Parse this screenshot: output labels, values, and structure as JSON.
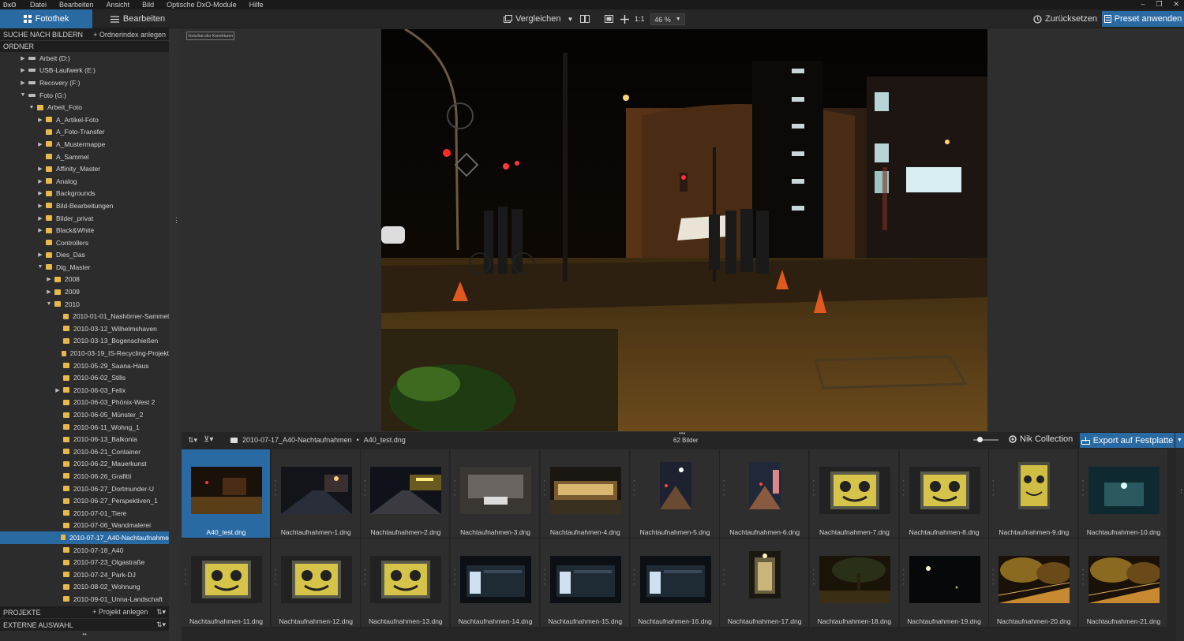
{
  "app": {
    "logo": "DxO"
  },
  "menu": [
    "Datei",
    "Bearbeiten",
    "Ansicht",
    "Bild",
    "Optische DxO-Module",
    "Hilfe"
  ],
  "window_controls": [
    "–",
    "❐",
    "✕"
  ],
  "tabs": {
    "library": "Fotothek",
    "edit": "Bearbeiten"
  },
  "toolbar": {
    "compare": "Vergleichen",
    "zoom_1_1": "1:1",
    "zoom_value": "46 %",
    "reset": "Zurücksetzen",
    "apply_preset": "Preset anwenden"
  },
  "left": {
    "search_header": "SUCHE NACH BILDERN",
    "index_action": "+ Ordnerindex anlegen",
    "folders_header": "ORDNER",
    "projects_header": "PROJEKTE",
    "project_action": "+ Projekt anlegen",
    "external_header": "EXTERNE AUSWAHL"
  },
  "tree": [
    {
      "label": "Arbeit (D:)",
      "level": 1,
      "type": "drive",
      "arrow": "right"
    },
    {
      "label": "USB-Laufwerk (E:)",
      "level": 1,
      "type": "drive",
      "arrow": "right"
    },
    {
      "label": "Recovery (F:)",
      "level": 1,
      "type": "drive",
      "arrow": "right"
    },
    {
      "label": "Foto (G:)",
      "level": 1,
      "type": "drive",
      "arrow": "down"
    },
    {
      "label": "Arbeit_Foto",
      "level": 2,
      "type": "folder",
      "arrow": "down"
    },
    {
      "label": "A_Artikel-Foto",
      "level": 3,
      "type": "folder",
      "arrow": "right"
    },
    {
      "label": "A_Foto-Transfer",
      "level": 3,
      "type": "folder",
      "arrow": ""
    },
    {
      "label": "A_Mustermappe",
      "level": 3,
      "type": "folder",
      "arrow": "right"
    },
    {
      "label": "A_Sammel",
      "level": 3,
      "type": "folder",
      "arrow": ""
    },
    {
      "label": "Affinity_Master",
      "level": 3,
      "type": "folder",
      "arrow": "right"
    },
    {
      "label": "Analog",
      "level": 3,
      "type": "folder",
      "arrow": "right"
    },
    {
      "label": "Backgrounds",
      "level": 3,
      "type": "folder",
      "arrow": "right"
    },
    {
      "label": "Bild-Bearbeitungen",
      "level": 3,
      "type": "folder",
      "arrow": "right"
    },
    {
      "label": "Bilder_privat",
      "level": 3,
      "type": "folder",
      "arrow": "right"
    },
    {
      "label": "Black&White",
      "level": 3,
      "type": "folder",
      "arrow": "right"
    },
    {
      "label": "Controllers",
      "level": 3,
      "type": "folder",
      "arrow": ""
    },
    {
      "label": "Dies_Das",
      "level": 3,
      "type": "folder",
      "arrow": "right"
    },
    {
      "label": "Dig_Master",
      "level": 3,
      "type": "folder",
      "arrow": "down"
    },
    {
      "label": "2008",
      "level": 4,
      "type": "folder",
      "arrow": "right"
    },
    {
      "label": "2009",
      "level": 4,
      "type": "folder",
      "arrow": "right"
    },
    {
      "label": "2010",
      "level": 4,
      "type": "folder",
      "arrow": "down"
    },
    {
      "label": "2010-01-01_Nashörner-Sammel",
      "level": 5,
      "type": "folder",
      "arrow": ""
    },
    {
      "label": "2010-03-12_Wilhelmshaven",
      "level": 5,
      "type": "folder",
      "arrow": ""
    },
    {
      "label": "2010-03-13_Bogenschießen",
      "level": 5,
      "type": "folder",
      "arrow": ""
    },
    {
      "label": "2010-03-19_IS-Recycling-Projekt",
      "level": 5,
      "type": "folder",
      "arrow": ""
    },
    {
      "label": "2010-05-29_Saana-Haus",
      "level": 5,
      "type": "folder",
      "arrow": ""
    },
    {
      "label": "2010-06-02_Stills",
      "level": 5,
      "type": "folder",
      "arrow": ""
    },
    {
      "label": "2010-06-03_Felix",
      "level": 5,
      "type": "folder",
      "arrow": "right"
    },
    {
      "label": "2010-06-03_Phönix-West 2",
      "level": 5,
      "type": "folder",
      "arrow": ""
    },
    {
      "label": "2010-06-05_Münster_2",
      "level": 5,
      "type": "folder",
      "arrow": ""
    },
    {
      "label": "2010-06-11_Wohng_1",
      "level": 5,
      "type": "folder",
      "arrow": ""
    },
    {
      "label": "2010-06-13_Balkonia",
      "level": 5,
      "type": "folder",
      "arrow": ""
    },
    {
      "label": "2010-06-21_Container",
      "level": 5,
      "type": "folder",
      "arrow": ""
    },
    {
      "label": "2010-06-22_Mauerkunst",
      "level": 5,
      "type": "folder",
      "arrow": ""
    },
    {
      "label": "2010-06-26_Grafitti",
      "level": 5,
      "type": "folder",
      "arrow": ""
    },
    {
      "label": "2010-06-27_Dortmunder-U",
      "level": 5,
      "type": "folder",
      "arrow": ""
    },
    {
      "label": "2010-06-27_Perspektiven_1",
      "level": 5,
      "type": "folder",
      "arrow": ""
    },
    {
      "label": "2010-07-01_Tiere",
      "level": 5,
      "type": "folder",
      "arrow": ""
    },
    {
      "label": "2010-07-06_Wandmalerei",
      "level": 5,
      "type": "folder",
      "arrow": ""
    },
    {
      "label": "2010-07-17_A40-Nachtaufnahme",
      "level": 5,
      "type": "folder",
      "arrow": "",
      "selected": true
    },
    {
      "label": "2010-07-18_A40",
      "level": 5,
      "type": "folder",
      "arrow": ""
    },
    {
      "label": "2010-07-23_Olgastraße",
      "level": 5,
      "type": "folder",
      "arrow": ""
    },
    {
      "label": "2010-07-24_Park-DJ",
      "level": 5,
      "type": "folder",
      "arrow": ""
    },
    {
      "label": "2010-08-02_Wohnung",
      "level": 5,
      "type": "folder",
      "arrow": ""
    },
    {
      "label": "2010-09-01_Unna-Landschaft",
      "level": 5,
      "type": "folder",
      "arrow": ""
    }
  ],
  "viewer": {
    "preview_tag": "Vorschau der Korrekturen"
  },
  "filmbar": {
    "folder": "2010-07-17_A40-Nachtaufnahmen",
    "separator": "•",
    "file": "A40_test.dng",
    "count": "62 Bilder",
    "nik": "Nik Collection",
    "export": "Export auf Festplatte",
    "thumb_size": 0.25
  },
  "thumbnails": [
    {
      "name": "A40_test.dng",
      "selected": true,
      "scene": "street"
    },
    {
      "name": "Nachtaufnahmen-1.dng",
      "scene": "road"
    },
    {
      "name": "Nachtaufnahmen-2.dng",
      "scene": "road2"
    },
    {
      "name": "Nachtaufnahmen-3.dng",
      "scene": "room"
    },
    {
      "name": "Nachtaufnahmen-4.dng",
      "scene": "shop"
    },
    {
      "name": "Nachtaufnahmen-5.dng",
      "scene": "portrait_street"
    },
    {
      "name": "Nachtaufnahmen-6.dng",
      "scene": "portrait_lane"
    },
    {
      "name": "Nachtaufnahmen-7.dng",
      "scene": "face"
    },
    {
      "name": "Nachtaufnahmen-8.dng",
      "scene": "face"
    },
    {
      "name": "Nachtaufnahmen-9.dng",
      "scene": "face_portrait"
    },
    {
      "name": "Nachtaufnahmen-10.dng",
      "scene": "teal"
    },
    {
      "name": "Nachtaufnahmen-11.dng",
      "scene": "face"
    },
    {
      "name": "Nachtaufnahmen-12.dng",
      "scene": "face"
    },
    {
      "name": "Nachtaufnahmen-13.dng",
      "scene": "face"
    },
    {
      "name": "Nachtaufnahmen-14.dng",
      "scene": "shelter"
    },
    {
      "name": "Nachtaufnahmen-15.dng",
      "scene": "shelter"
    },
    {
      "name": "Nachtaufnahmen-16.dng",
      "scene": "shelter"
    },
    {
      "name": "Nachtaufnahmen-17.dng",
      "scene": "door"
    },
    {
      "name": "Nachtaufnahmen-18.dng",
      "scene": "tree"
    },
    {
      "name": "Nachtaufnahmen-19.dng",
      "scene": "dark"
    },
    {
      "name": "Nachtaufnahmen-20.dng",
      "scene": "orange"
    },
    {
      "name": "Nachtaufnahmen-21.dng",
      "scene": "orange"
    }
  ],
  "colors": {
    "accent": "#2a6aa3",
    "folder": "#e8b84a",
    "panel": "#2c2c2c",
    "header": "#1e1e1e"
  }
}
